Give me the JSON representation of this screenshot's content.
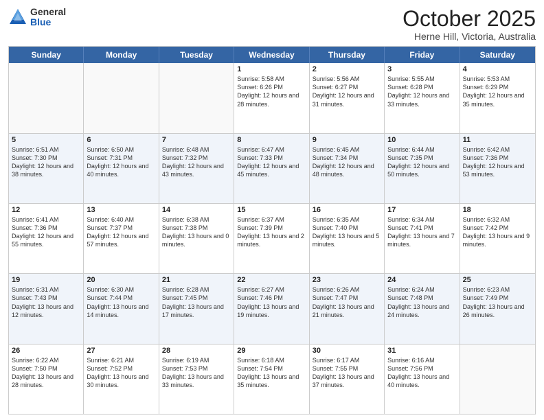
{
  "header": {
    "logo_general": "General",
    "logo_blue": "Blue",
    "month_title": "October 2025",
    "location": "Herne Hill, Victoria, Australia"
  },
  "days_of_week": [
    "Sunday",
    "Monday",
    "Tuesday",
    "Wednesday",
    "Thursday",
    "Friday",
    "Saturday"
  ],
  "rows": [
    [
      {
        "day": "",
        "sunrise": "",
        "sunset": "",
        "daylight": ""
      },
      {
        "day": "",
        "sunrise": "",
        "sunset": "",
        "daylight": ""
      },
      {
        "day": "",
        "sunrise": "",
        "sunset": "",
        "daylight": ""
      },
      {
        "day": "1",
        "sunrise": "Sunrise: 5:58 AM",
        "sunset": "Sunset: 6:26 PM",
        "daylight": "Daylight: 12 hours and 28 minutes."
      },
      {
        "day": "2",
        "sunrise": "Sunrise: 5:56 AM",
        "sunset": "Sunset: 6:27 PM",
        "daylight": "Daylight: 12 hours and 31 minutes."
      },
      {
        "day": "3",
        "sunrise": "Sunrise: 5:55 AM",
        "sunset": "Sunset: 6:28 PM",
        "daylight": "Daylight: 12 hours and 33 minutes."
      },
      {
        "day": "4",
        "sunrise": "Sunrise: 5:53 AM",
        "sunset": "Sunset: 6:29 PM",
        "daylight": "Daylight: 12 hours and 35 minutes."
      }
    ],
    [
      {
        "day": "5",
        "sunrise": "Sunrise: 6:51 AM",
        "sunset": "Sunset: 7:30 PM",
        "daylight": "Daylight: 12 hours and 38 minutes."
      },
      {
        "day": "6",
        "sunrise": "Sunrise: 6:50 AM",
        "sunset": "Sunset: 7:31 PM",
        "daylight": "Daylight: 12 hours and 40 minutes."
      },
      {
        "day": "7",
        "sunrise": "Sunrise: 6:48 AM",
        "sunset": "Sunset: 7:32 PM",
        "daylight": "Daylight: 12 hours and 43 minutes."
      },
      {
        "day": "8",
        "sunrise": "Sunrise: 6:47 AM",
        "sunset": "Sunset: 7:33 PM",
        "daylight": "Daylight: 12 hours and 45 minutes."
      },
      {
        "day": "9",
        "sunrise": "Sunrise: 6:45 AM",
        "sunset": "Sunset: 7:34 PM",
        "daylight": "Daylight: 12 hours and 48 minutes."
      },
      {
        "day": "10",
        "sunrise": "Sunrise: 6:44 AM",
        "sunset": "Sunset: 7:35 PM",
        "daylight": "Daylight: 12 hours and 50 minutes."
      },
      {
        "day": "11",
        "sunrise": "Sunrise: 6:42 AM",
        "sunset": "Sunset: 7:36 PM",
        "daylight": "Daylight: 12 hours and 53 minutes."
      }
    ],
    [
      {
        "day": "12",
        "sunrise": "Sunrise: 6:41 AM",
        "sunset": "Sunset: 7:36 PM",
        "daylight": "Daylight: 12 hours and 55 minutes."
      },
      {
        "day": "13",
        "sunrise": "Sunrise: 6:40 AM",
        "sunset": "Sunset: 7:37 PM",
        "daylight": "Daylight: 12 hours and 57 minutes."
      },
      {
        "day": "14",
        "sunrise": "Sunrise: 6:38 AM",
        "sunset": "Sunset: 7:38 PM",
        "daylight": "Daylight: 13 hours and 0 minutes."
      },
      {
        "day": "15",
        "sunrise": "Sunrise: 6:37 AM",
        "sunset": "Sunset: 7:39 PM",
        "daylight": "Daylight: 13 hours and 2 minutes."
      },
      {
        "day": "16",
        "sunrise": "Sunrise: 6:35 AM",
        "sunset": "Sunset: 7:40 PM",
        "daylight": "Daylight: 13 hours and 5 minutes."
      },
      {
        "day": "17",
        "sunrise": "Sunrise: 6:34 AM",
        "sunset": "Sunset: 7:41 PM",
        "daylight": "Daylight: 13 hours and 7 minutes."
      },
      {
        "day": "18",
        "sunrise": "Sunrise: 6:32 AM",
        "sunset": "Sunset: 7:42 PM",
        "daylight": "Daylight: 13 hours and 9 minutes."
      }
    ],
    [
      {
        "day": "19",
        "sunrise": "Sunrise: 6:31 AM",
        "sunset": "Sunset: 7:43 PM",
        "daylight": "Daylight: 13 hours and 12 minutes."
      },
      {
        "day": "20",
        "sunrise": "Sunrise: 6:30 AM",
        "sunset": "Sunset: 7:44 PM",
        "daylight": "Daylight: 13 hours and 14 minutes."
      },
      {
        "day": "21",
        "sunrise": "Sunrise: 6:28 AM",
        "sunset": "Sunset: 7:45 PM",
        "daylight": "Daylight: 13 hours and 17 minutes."
      },
      {
        "day": "22",
        "sunrise": "Sunrise: 6:27 AM",
        "sunset": "Sunset: 7:46 PM",
        "daylight": "Daylight: 13 hours and 19 minutes."
      },
      {
        "day": "23",
        "sunrise": "Sunrise: 6:26 AM",
        "sunset": "Sunset: 7:47 PM",
        "daylight": "Daylight: 13 hours and 21 minutes."
      },
      {
        "day": "24",
        "sunrise": "Sunrise: 6:24 AM",
        "sunset": "Sunset: 7:48 PM",
        "daylight": "Daylight: 13 hours and 24 minutes."
      },
      {
        "day": "25",
        "sunrise": "Sunrise: 6:23 AM",
        "sunset": "Sunset: 7:49 PM",
        "daylight": "Daylight: 13 hours and 26 minutes."
      }
    ],
    [
      {
        "day": "26",
        "sunrise": "Sunrise: 6:22 AM",
        "sunset": "Sunset: 7:50 PM",
        "daylight": "Daylight: 13 hours and 28 minutes."
      },
      {
        "day": "27",
        "sunrise": "Sunrise: 6:21 AM",
        "sunset": "Sunset: 7:52 PM",
        "daylight": "Daylight: 13 hours and 30 minutes."
      },
      {
        "day": "28",
        "sunrise": "Sunrise: 6:19 AM",
        "sunset": "Sunset: 7:53 PM",
        "daylight": "Daylight: 13 hours and 33 minutes."
      },
      {
        "day": "29",
        "sunrise": "Sunrise: 6:18 AM",
        "sunset": "Sunset: 7:54 PM",
        "daylight": "Daylight: 13 hours and 35 minutes."
      },
      {
        "day": "30",
        "sunrise": "Sunrise: 6:17 AM",
        "sunset": "Sunset: 7:55 PM",
        "daylight": "Daylight: 13 hours and 37 minutes."
      },
      {
        "day": "31",
        "sunrise": "Sunrise: 6:16 AM",
        "sunset": "Sunset: 7:56 PM",
        "daylight": "Daylight: 13 hours and 40 minutes."
      },
      {
        "day": "",
        "sunrise": "",
        "sunset": "",
        "daylight": ""
      }
    ]
  ]
}
